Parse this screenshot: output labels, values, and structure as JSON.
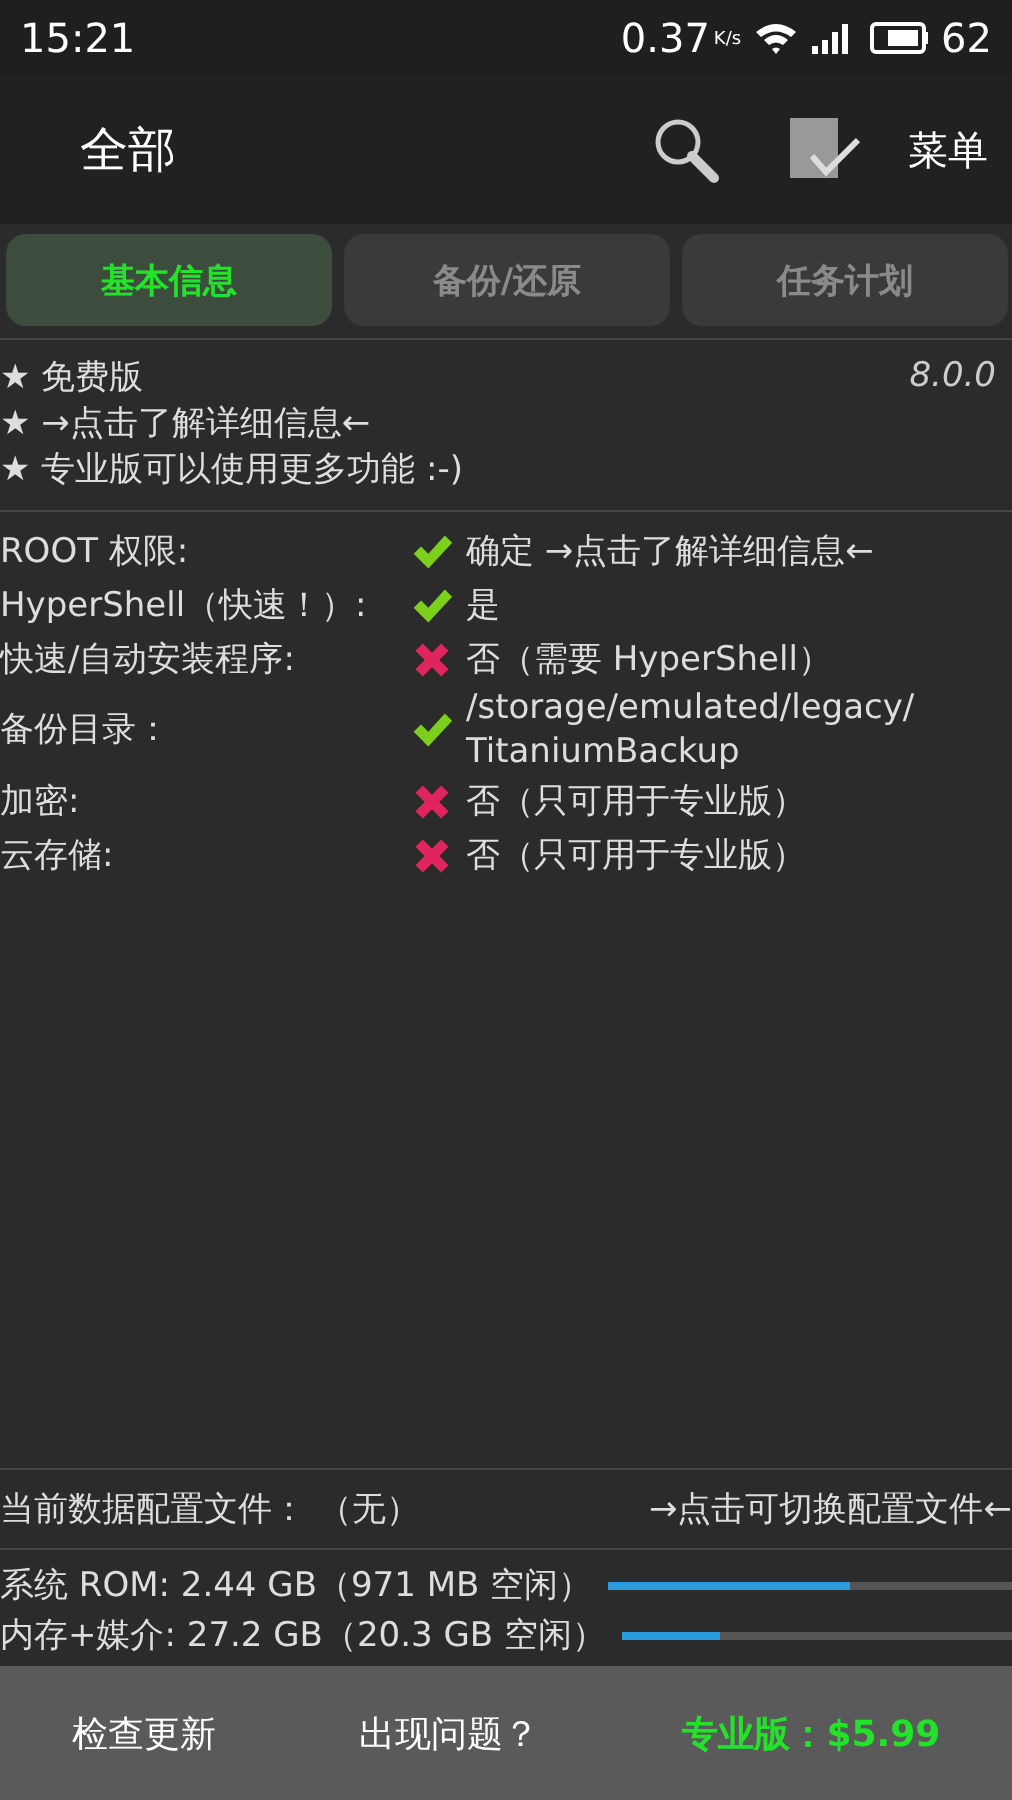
{
  "status_bar": {
    "time": "15:21",
    "speed": "0.37",
    "speed_unit": "K/s",
    "battery": "62"
  },
  "app_bar": {
    "title": "全部",
    "menu": "菜单"
  },
  "tabs": [
    {
      "label": "基本信息",
      "selected": true
    },
    {
      "label": "备份/还原",
      "selected": false
    },
    {
      "label": "任务计划",
      "selected": false
    }
  ],
  "about": {
    "lines": [
      "★ 免费版",
      "★ →点击了解详细信息←",
      "★ 专业版可以使用更多功能 :-)"
    ],
    "version": "8.0.0"
  },
  "info_rows": [
    {
      "label": "ROOT 权限:",
      "ok": true,
      "value": "确定 →点击了解详细信息←"
    },
    {
      "label": "HyperShell（快速！）:",
      "ok": true,
      "value": "是"
    },
    {
      "label": "快速/自动安装程序:",
      "ok": false,
      "value": "否（需要 HyperShell）"
    },
    {
      "label": "备份目录：",
      "ok": true,
      "value": "/storage/emulated/legacy/ TitaniumBackup"
    },
    {
      "label": "加密:",
      "ok": false,
      "value": "否（只可用于专业版）"
    },
    {
      "label": "云存储:",
      "ok": false,
      "value": "否（只可用于专业版）"
    }
  ],
  "profile": {
    "label": "当前数据配置文件：",
    "value": "（无）",
    "link": "→点击可切换配置文件←"
  },
  "storage": [
    {
      "label": "系统 ROM: 2.44 GB（971 MB 空闲）",
      "level": 0.6
    },
    {
      "label": "内存+媒介: 27.2 GB（20.3 GB 空闲）",
      "level": 0.25
    }
  ],
  "footer": [
    {
      "label": "检查更新",
      "kind": "plain"
    },
    {
      "label": "出现问题？",
      "kind": "plain"
    },
    {
      "label": "专业版：$5.99",
      "kind": "promo"
    }
  ]
}
